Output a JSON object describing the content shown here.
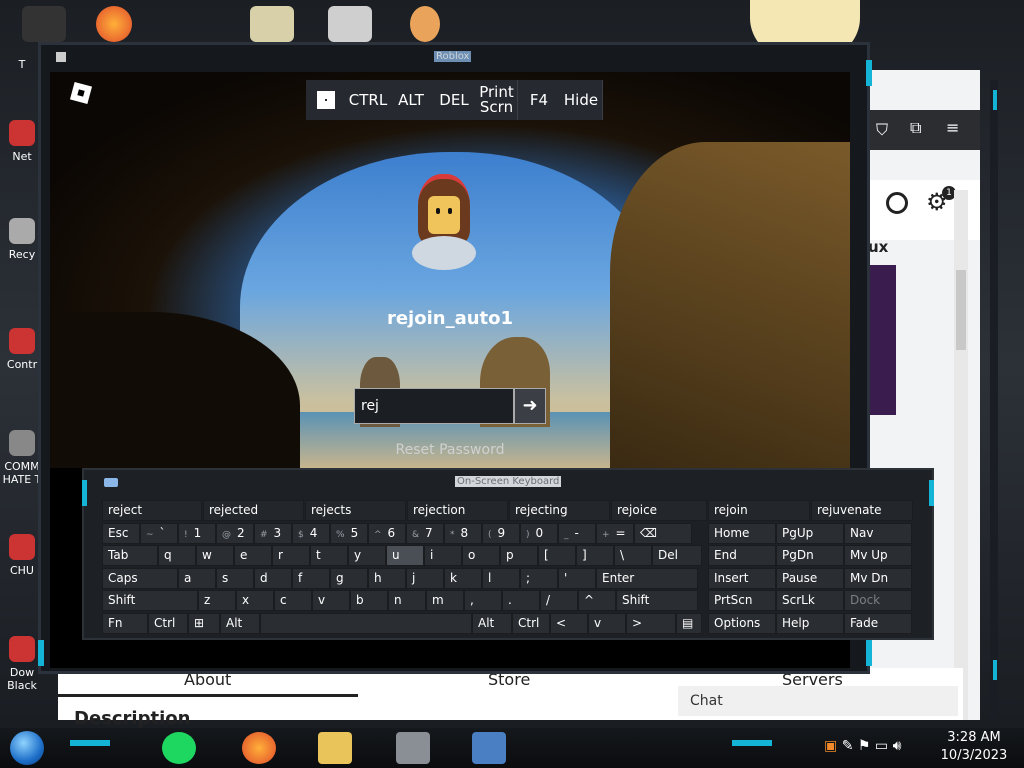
{
  "window": {
    "title": "Roblox"
  },
  "desktop_labels": [
    "T",
    "Net",
    "Recy",
    "Contr",
    "COMM",
    "HATE T",
    "CHU",
    "Dow",
    "Black"
  ],
  "browser": {
    "sidebar_text": "ux"
  },
  "web_page": {
    "tabs": [
      "About",
      "Store",
      "Servers"
    ],
    "heading": "Description",
    "chat": "Chat",
    "notif_count": "1"
  },
  "command_bar": {
    "buttons": [
      {
        "id": "windows",
        "label": ""
      },
      {
        "id": "ctrl",
        "label": "CTRL"
      },
      {
        "id": "alt",
        "label": "ALT"
      },
      {
        "id": "del",
        "label": "DEL"
      },
      {
        "id": "print",
        "label": "Print Scrn"
      },
      {
        "id": "f4",
        "label": "F4"
      },
      {
        "id": "hide",
        "label": "Hide"
      }
    ]
  },
  "login": {
    "username": "rejoin_auto1",
    "password_value": "rej",
    "submit_glyph": "➜",
    "reset_label": "Reset Password"
  },
  "osk": {
    "title": "On-Screen Keyboard",
    "suggestions": [
      "reject",
      "rejected",
      "rejects",
      "rejection",
      "rejecting",
      "rejoice",
      "rejoin",
      "rejuvenate"
    ],
    "row1": [
      [
        "Esc",
        ""
      ],
      [
        "`",
        "~"
      ],
      [
        "1",
        "!"
      ],
      [
        "2",
        "@"
      ],
      [
        "3",
        "#"
      ],
      [
        "4",
        "$"
      ],
      [
        "5",
        "%"
      ],
      [
        "6",
        "^"
      ],
      [
        "7",
        "&"
      ],
      [
        "8",
        "*"
      ],
      [
        "9",
        "("
      ],
      [
        "0",
        ")"
      ],
      [
        "-",
        "_"
      ],
      [
        "=",
        "+"
      ],
      [
        "⌫",
        ""
      ]
    ],
    "row2": [
      "Tab",
      "q",
      "w",
      "e",
      "r",
      "t",
      "y",
      "u",
      "i",
      "o",
      "p",
      "[",
      "]",
      "\\",
      "Del"
    ],
    "row3": [
      "Caps",
      "a",
      "s",
      "d",
      "f",
      "g",
      "h",
      "j",
      "k",
      "l",
      ";",
      "'",
      "Enter"
    ],
    "row4": [
      "Shift",
      "z",
      "x",
      "c",
      "v",
      "b",
      "n",
      "m",
      ",",
      ".",
      "/",
      "^",
      "Shift"
    ],
    "row5": [
      "Fn",
      "Ctrl",
      "⊞",
      "Alt",
      "",
      "Alt",
      "Ctrl",
      "<",
      "v",
      ">",
      "▤"
    ],
    "nav": [
      [
        "Home",
        "PgUp",
        "Nav"
      ],
      [
        "End",
        "PgDn",
        "Mv Up"
      ],
      [
        "Insert",
        "Pause",
        "Mv Dn"
      ],
      [
        "PrtScn",
        "ScrLk",
        "Dock"
      ],
      [
        "Options",
        "Help",
        "Fade"
      ]
    ]
  },
  "taskbar": {
    "time": "3:28 AM",
    "date": "10/3/2023"
  }
}
